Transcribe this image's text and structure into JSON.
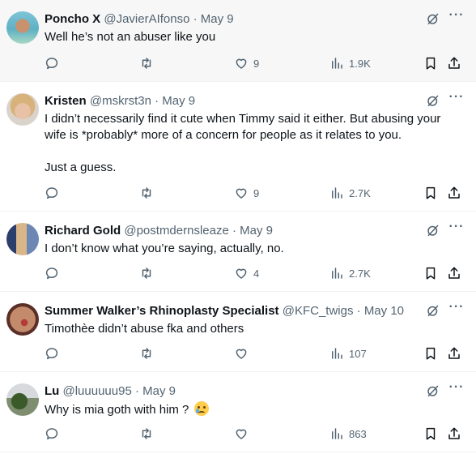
{
  "tweets": [
    {
      "name": "Poncho X",
      "handle": "@JavierAIfonso",
      "dot": "·",
      "date": "May 9",
      "text": [
        "Well he’s not an abuser like you"
      ],
      "likes": "9",
      "views": "1.9K"
    },
    {
      "name": "Kristen",
      "handle": "@mskrst3n",
      "dot": "·",
      "date": "May 9",
      "text": [
        "I didn’t necessarily find it cute when Timmy said it either. But abusing your wife is *probably* more of a concern for people as it relates to you.",
        "Just a guess."
      ],
      "likes": "9",
      "views": "2.7K"
    },
    {
      "name": "Richard Gold",
      "handle": "@postmdernsleaze",
      "dot": "·",
      "date": "May 9",
      "text": [
        "I don’t know what you’re saying, actually, no."
      ],
      "likes": "4",
      "views": "2.7K"
    },
    {
      "name": "Summer Walker’s Rhinoplasty Specialist",
      "handle": "@KFC_twigs",
      "dot": "·",
      "date": "May 10",
      "text": [
        "Timothèe didn’t abuse fka and others"
      ],
      "likes": "",
      "views": "107"
    },
    {
      "name": "Lu",
      "handle": "@luuuuuu95",
      "dot": "·",
      "date": "May 9",
      "text": [
        "Why is mia goth with him ?"
      ],
      "likes": "",
      "views": "863"
    }
  ],
  "icons": {
    "reply": "reply-icon",
    "retweet": "retweet-icon",
    "like": "heart-icon",
    "views": "views-icon",
    "bookmark": "bookmark-icon",
    "share": "share-icon",
    "grok": "grok-icon",
    "more": "more-icon"
  },
  "colors": {
    "text": "#0f1419",
    "secondary": "#536471",
    "divider": "#eff3f4"
  }
}
